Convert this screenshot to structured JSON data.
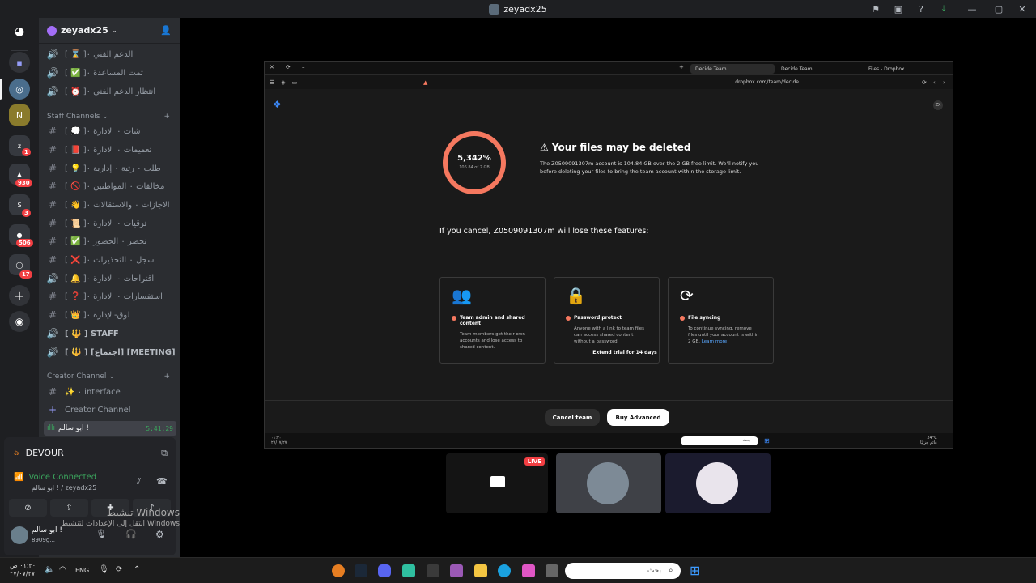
{
  "window": {
    "title": "zeyadx25"
  },
  "server": {
    "name": "zeyadx25"
  },
  "server_badges": [
    "1",
    "930",
    "3",
    "506",
    "17"
  ],
  "channels": [
    {
      "sym": "🔊",
      "label": "[ ⌛ ]۰ الدعم الفني",
      "emoji_color": "#c8c8c8"
    },
    {
      "sym": "🔊",
      "label": "[ ✅ ]۰ تمت المساعدة",
      "emoji_color": "#3ba55d"
    },
    {
      "sym": "🔊",
      "label": "[ ⏰ ]۰ انتظار الدعم الفني",
      "emoji_color": "#e05b8f"
    }
  ],
  "staff_category": "Staff Channels",
  "staff_channels": [
    {
      "sym": "#",
      "label": "[ 💭 ]۰ شات ۰ الادارة"
    },
    {
      "sym": "#",
      "label": "[ 📕 ]۰ تعميمات ۰ الادارة"
    },
    {
      "sym": "#",
      "label": "[ 💡 ]۰ طلب ۰ رتبة ۰ إدارية"
    },
    {
      "sym": "#",
      "label": "[ 🚫 ]۰ مخالفات ۰ المواطنين"
    },
    {
      "sym": "#",
      "label": "[ 👋 ]۰ الاجازات ۰ والاستقالات"
    },
    {
      "sym": "#",
      "label": "[ 📜 ]۰ ترقيات ۰ الادارة"
    },
    {
      "sym": "#",
      "label": "[ ✅ ]۰ تحضر ۰ الحضور"
    },
    {
      "sym": "#",
      "label": "[ ❌ ]۰ سجل ۰ التحذيرات"
    },
    {
      "sym": "🔊",
      "label": "[ 🔔 ]۰ اقتراحات ۰ الادارة"
    },
    {
      "sym": "#",
      "label": "[ ❓ ]۰ استفسارات ۰ الادارة"
    },
    {
      "sym": "#",
      "label": "[ 👑 ]۰ لوق-الإدارة"
    },
    {
      "sym": "🔊",
      "label": "[ 🔱 ] STAFF"
    },
    {
      "sym": "🔊",
      "label": "[ 🔱 ] [اجتماع] [MEETING]"
    }
  ],
  "creator_category": "Creator Channel",
  "creator_channels": [
    {
      "sym": "#",
      "label": "✨ ۰ interface"
    },
    {
      "sym": "+",
      "label": "Creator Channel"
    }
  ],
  "voice_user": {
    "name": "ابو سالم !",
    "time": "5:41:29"
  },
  "activity": {
    "title": "DEVOUR"
  },
  "voice": {
    "status": "Voice Connected",
    "channel": "ابو سالم ! / zeyadx25"
  },
  "user": {
    "name": "ابو سالم !",
    "tag": "8909g..."
  },
  "activation": {
    "line1": "تنشيط Windows",
    "line2": "انتقل إلى الإعدادات لتنشيط Windows"
  },
  "browser": {
    "tabs": [
      "Decide Team",
      "Decide Team",
      "Files - Dropbox"
    ],
    "url": "dropbox.com/team/decide",
    "time": "٠١:٣٠",
    "date": "٢٧/٠٧/٢٧",
    "weather": "24°C",
    "weather_desc": "غائم جزئيًا",
    "search_placeholder": "بحث",
    "avatar": "ZX"
  },
  "dropbox": {
    "percent": "5,342%",
    "usage": "106.84 of 2 GB",
    "usage_fraction": 1.0,
    "warning_title": "⚠ Your files may be deleted",
    "warning_body": "The Z0509091307m account is 104.84 GB over the 2 GB free limit. We'll notify you before deleting your files to bring the team account within the storage limit.",
    "lose_heading": "If you cancel, Z0509091307m will lose these features:",
    "features": [
      {
        "icon": "👥",
        "title": "Team admin and shared content",
        "desc": "Team members get their own accounts and lose access to shared content."
      },
      {
        "icon": "🔒",
        "title": "Password protect",
        "desc": "Anyone with a link to team files can access shared content without a password."
      },
      {
        "icon": "⟳",
        "title": "File syncing",
        "desc": "To continue syncing, remove files until your account is within 2 GB.",
        "link": "Learn more"
      }
    ],
    "extend": "Extend trial for 14 days",
    "cancel": "Cancel team",
    "buy": "Buy Advanced"
  },
  "live_label": "LIVE",
  "taskbar": {
    "time": "٠١:٣٠",
    "ampm": "ص",
    "date": "٢٧/٠٧/٢٧",
    "lang": "ENG",
    "search_placeholder": "بحث"
  }
}
